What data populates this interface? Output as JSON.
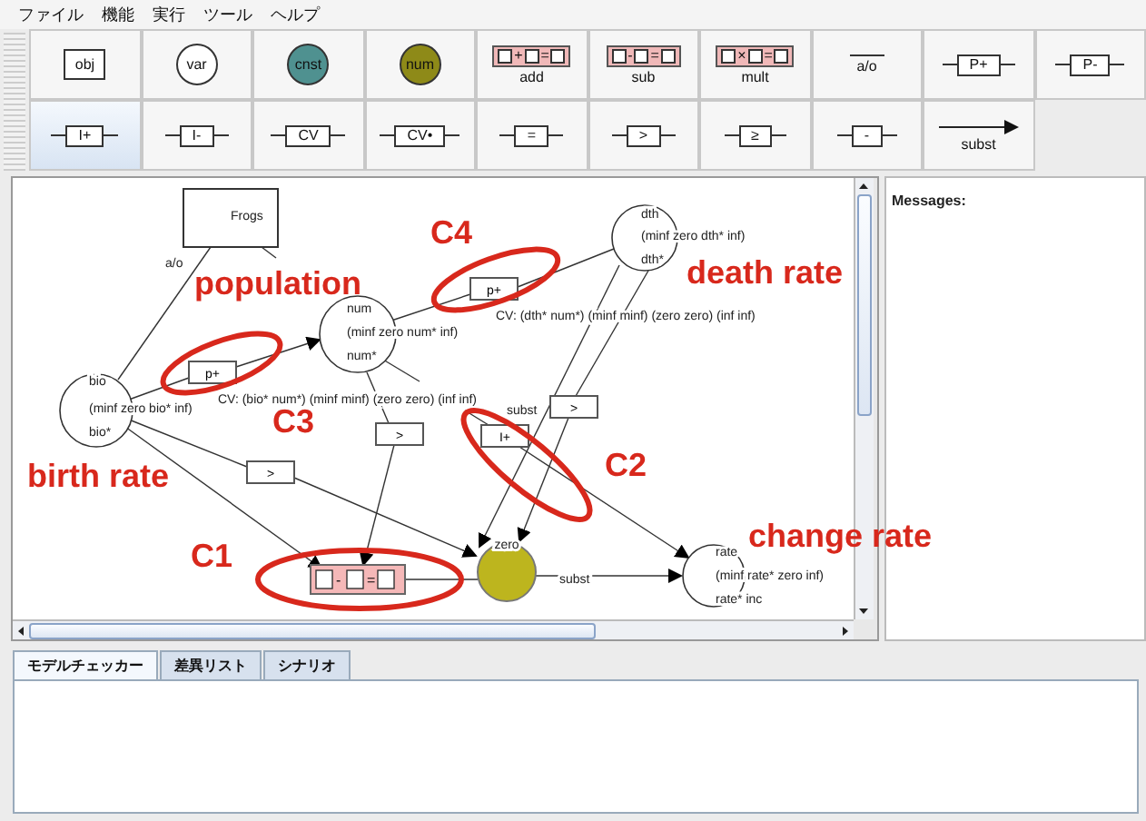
{
  "menu": [
    "ファイル",
    "機能",
    "実行",
    "ツール",
    "ヘルプ"
  ],
  "palette": [
    {
      "kind": "object",
      "label": "obj",
      "selected": false
    },
    {
      "kind": "variable",
      "label": "var",
      "selected": false
    },
    {
      "kind": "constant",
      "label": "cnst",
      "selected": false
    },
    {
      "kind": "number",
      "label": "num",
      "selected": false
    },
    {
      "kind": "operator",
      "label": "add",
      "symbols": [
        "+",
        "="
      ],
      "selected": false
    },
    {
      "kind": "operator",
      "label": "sub",
      "symbols": [
        "-",
        "="
      ],
      "selected": false
    },
    {
      "kind": "operator",
      "label": "mult",
      "symbols": [
        "×",
        "="
      ],
      "selected": false
    },
    {
      "kind": "link",
      "label": "a/o",
      "selected": false
    },
    {
      "kind": "relation",
      "label": "P+",
      "selected": false
    },
    {
      "kind": "relation",
      "label": "P-",
      "selected": false
    },
    {
      "kind": "relation",
      "label": "I+",
      "selected": true
    },
    {
      "kind": "relation",
      "label": "I-",
      "selected": false
    },
    {
      "kind": "relation",
      "label": "CV",
      "selected": false
    },
    {
      "kind": "relation",
      "label": "CV•",
      "selected": false
    },
    {
      "kind": "relation",
      "label": "=",
      "selected": false
    },
    {
      "kind": "relation",
      "label": ">",
      "selected": false
    },
    {
      "kind": "relation",
      "label": "≥",
      "selected": false
    },
    {
      "kind": "relation",
      "label": "-",
      "selected": false
    },
    {
      "kind": "arrow",
      "label": "subst",
      "selected": false
    }
  ],
  "diagram": {
    "nodes": [
      {
        "kind": "object",
        "lines": [
          "Frogs"
        ]
      },
      {
        "kind": "variable",
        "lines": [
          "num",
          "(minf zero num* inf)",
          "num*"
        ]
      },
      {
        "kind": "variable",
        "lines": [
          "bio",
          "(minf zero bio* inf)",
          "bio*"
        ]
      },
      {
        "kind": "variable",
        "lines": [
          "dth",
          "(minf zero dth* inf)",
          "dth*"
        ]
      },
      {
        "kind": "number",
        "lines": [
          "zero"
        ]
      },
      {
        "kind": "variable",
        "lines": [
          "rate",
          "(minf rate* zero inf)",
          "rate* inc"
        ]
      }
    ],
    "relations": [
      {
        "kind": "box",
        "label": "p+"
      },
      {
        "kind": "box",
        "label": "p+"
      },
      {
        "kind": "box",
        "label": ">"
      },
      {
        "kind": "box",
        "label": ">"
      },
      {
        "kind": "box",
        "label": "I+"
      },
      {
        "kind": "box",
        "label": ">"
      },
      {
        "kind": "operator",
        "symbols": [
          "-",
          "="
        ]
      }
    ],
    "edge_labels": [
      "a/o",
      "CV: (bio* num*) (minf minf) (zero zero)  (inf inf)",
      "CV: (dth* num*) (minf minf) (zero zero) (inf inf)",
      "subst",
      "subst"
    ],
    "annotations": [
      "population",
      "C4",
      "death rate",
      "C3",
      "C2",
      "birth rate",
      "change rate",
      "C1"
    ]
  },
  "messages": {
    "title": "Messages:"
  },
  "tabs": [
    {
      "label": "モデルチェッカー",
      "selected": true
    },
    {
      "label": "差異リスト",
      "selected": false
    },
    {
      "label": "シナリオ",
      "selected": false
    }
  ]
}
